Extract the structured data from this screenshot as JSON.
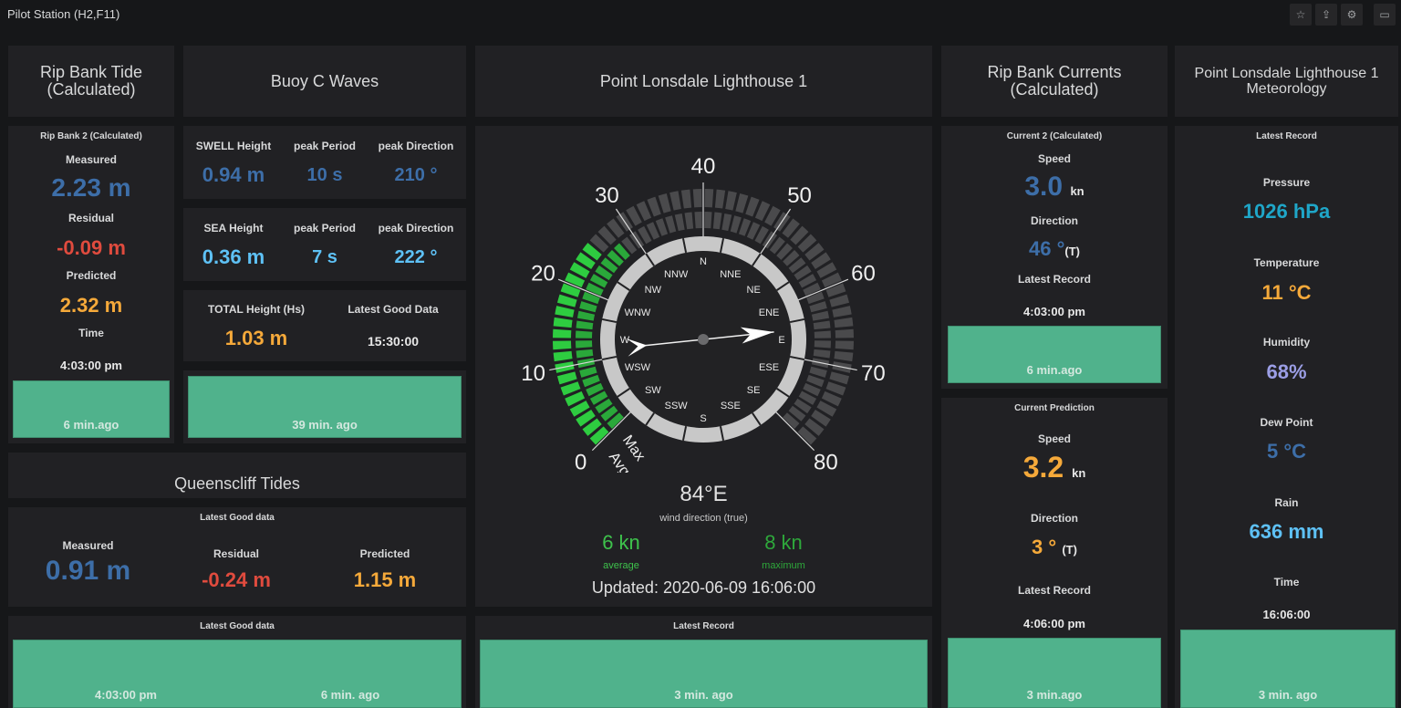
{
  "topbar": {
    "title": "Pilot Station (H2,F11)",
    "icons": [
      "star-icon",
      "share-icon",
      "gear-icon",
      "monitor-icon"
    ]
  },
  "colors": {
    "background": "#161719",
    "panel": "#212124",
    "status_ok": "#50b28c",
    "blue_dark": "#3d6ea8",
    "blue_light": "#5ec1f5",
    "red": "#e04b3e",
    "orange": "#f5a93a",
    "teal": "#1fa6c8",
    "violet": "#9b9ee5",
    "wind_green": "#2ecc40"
  },
  "rip_bank_tide": {
    "header": "Rip Bank Tide (Calculated)",
    "subtitle": "Rip Bank 2 (Calculated)",
    "measured_label": "Measured",
    "measured_value": "2.23 m",
    "residual_label": "Residual",
    "residual_value": "-0.09 m",
    "predicted_label": "Predicted",
    "predicted_value": "2.32 m",
    "time_label": "Time",
    "time_value": "4:03:00 pm",
    "ago": "6 min.ago"
  },
  "buoy_c_waves": {
    "header": "Buoy C Waves",
    "swell": {
      "height_label": "SWELL Height",
      "height_value": "0.94 m",
      "period_label": "peak Period",
      "period_value": "10 s",
      "direction_label": "peak Direction",
      "direction_value": "210 °"
    },
    "sea": {
      "height_label": "SEA Height",
      "height_value": "0.36 m",
      "period_label": "peak Period",
      "period_value": "7 s",
      "direction_label": "peak Direction",
      "direction_value": "222 °"
    },
    "total": {
      "height_label": "TOTAL Height (Hs)",
      "height_value": "1.03 m",
      "latest_label": "Latest Good Data",
      "latest_value": "15:30:00"
    },
    "ago": "39 min. ago"
  },
  "queenscliff_tides": {
    "header": "Queenscliff Tides",
    "subtitle": "Latest Good data",
    "measured_label": "Measured",
    "measured_value": "0.91 m",
    "residual_label": "Residual",
    "residual_value": "-0.24 m",
    "predicted_label": "Predicted",
    "predicted_value": "1.15 m",
    "status_subtitle": "Latest Good data",
    "status_time": "4:03:00 pm",
    "status_ago": "6 min. ago"
  },
  "lighthouse_wind": {
    "header": "Point Lonsdale Lighthouse 1",
    "direction_value": "84°E",
    "direction_degrees": 84,
    "direction_label": "wind direction (true)",
    "average_value": "6 kn",
    "average_knots": 6,
    "average_label": "average",
    "maximum_value": "8 kn",
    "maximum_knots": 8,
    "maximum_label": "maximum",
    "updated": "Updated: 2020-06-09 16:06:00",
    "scale_ticks": [
      "0",
      "10",
      "20",
      "30",
      "40",
      "50",
      "60",
      "70",
      "80"
    ],
    "scale_max": 80,
    "arc_labels": [
      "Avg",
      "Max"
    ],
    "compass_points": [
      "N",
      "NNE",
      "NE",
      "ENE",
      "E",
      "ESE",
      "SE",
      "SSE",
      "S",
      "SSW",
      "SW",
      "WSW",
      "W",
      "WNW",
      "NW",
      "NNW"
    ],
    "status_subtitle": "Latest Record",
    "status_ago": "3 min. ago"
  },
  "rip_bank_currents": {
    "header": "Rip Bank Currents (Calculated)",
    "calc": {
      "subtitle": "Current 2 (Calculated)",
      "speed_label": "Speed",
      "speed_value": "3.0",
      "speed_unit": "kn",
      "direction_label": "Direction",
      "direction_value": "46 °",
      "direction_unit": "(T)",
      "latest_label": "Latest Record",
      "latest_value": "4:03:00 pm",
      "ago": "6 min.ago"
    },
    "prediction": {
      "subtitle": "Current Prediction",
      "speed_label": "Speed",
      "speed_value": "3.2",
      "speed_unit": "kn",
      "direction_label": "Direction",
      "direction_value": "3 °",
      "direction_unit": "(T)",
      "latest_label": "Latest Record",
      "latest_value": "4:06:00 pm",
      "ago": "3 min.ago"
    }
  },
  "lighthouse_met": {
    "header": "Point Lonsdale Lighthouse 1 Meteorology",
    "subtitle": "Latest Record",
    "pressure_label": "Pressure",
    "pressure_value": "1026 hPa",
    "temperature_label": "Temperature",
    "temperature_value": "11 °C",
    "humidity_label": "Humidity",
    "humidity_value": "68%",
    "dewpoint_label": "Dew Point",
    "dewpoint_value": "5 °C",
    "rain_label": "Rain",
    "rain_value": "636 mm",
    "time_label": "Time",
    "time_value": "16:06:00",
    "ago": "3 min. ago"
  }
}
